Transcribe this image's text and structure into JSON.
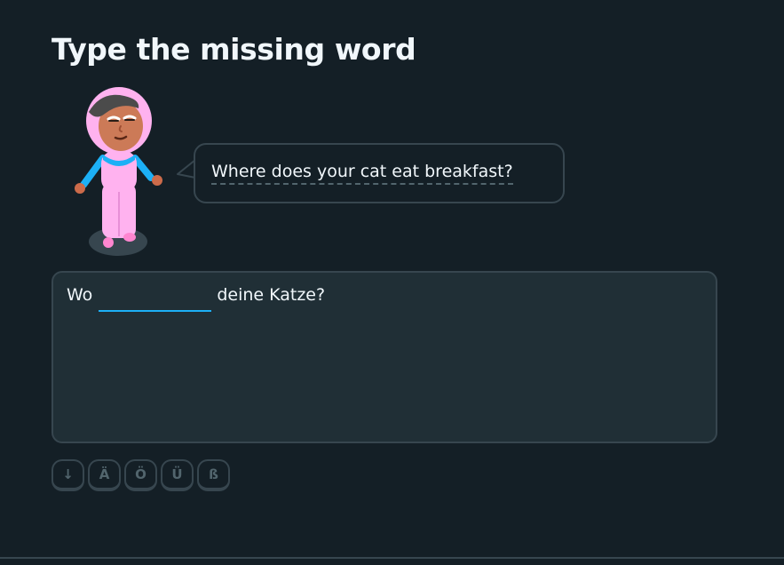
{
  "title": "Type the missing word",
  "prompt": {
    "text": "Where does your cat eat breakfast?"
  },
  "sentence": {
    "before": "Wo",
    "blank_value": "",
    "after": "deine Katze?"
  },
  "special_keys": [
    {
      "label": "↓",
      "name": "collapse-keyboard-button"
    },
    {
      "label": "Ä",
      "name": "key-a-umlaut"
    },
    {
      "label": "Ö",
      "name": "key-o-umlaut"
    },
    {
      "label": "Ü",
      "name": "key-u-umlaut"
    },
    {
      "label": "ß",
      "name": "key-eszett"
    }
  ],
  "colors": {
    "background": "#141f26",
    "panel": "#202f36",
    "border": "#37464f",
    "accent": "#1cb0f6",
    "text": "#f1f7fb",
    "muted": "#52656d"
  }
}
